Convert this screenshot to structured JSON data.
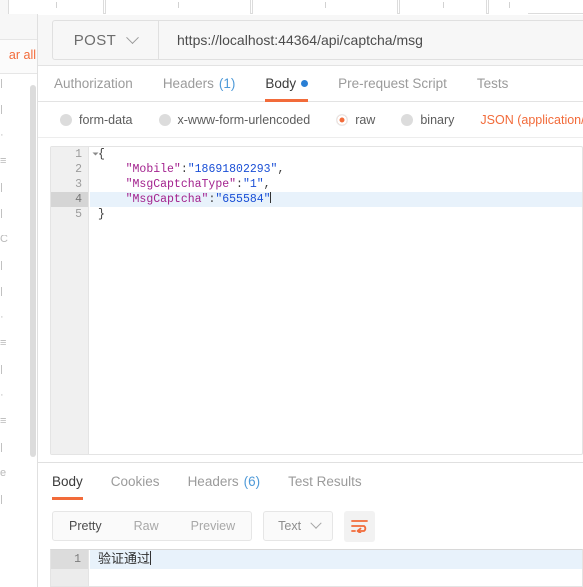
{
  "sidebar": {
    "clear_all_label": "ar all",
    "truncated_items": [
      "|",
      "|",
      "·",
      "≡",
      "|",
      "|",
      "C",
      "|",
      "|",
      "·",
      "≡",
      "|",
      "·",
      "≡",
      "|",
      "e",
      "|"
    ]
  },
  "request": {
    "method": "POST",
    "url": "https://localhost:44364/api/captcha/msg",
    "tabs": [
      {
        "label": "Authorization",
        "count": "",
        "active": false,
        "dot": false
      },
      {
        "label": "Headers",
        "count": "(1)",
        "active": false,
        "dot": false
      },
      {
        "label": "Body",
        "count": "",
        "active": true,
        "dot": true
      },
      {
        "label": "Pre-request Script",
        "count": "",
        "active": false,
        "dot": false
      },
      {
        "label": "Tests",
        "count": "",
        "active": false,
        "dot": false
      }
    ],
    "body_types": [
      {
        "label": "form-data",
        "selected": false
      },
      {
        "label": "x-www-form-urlencoded",
        "selected": false
      },
      {
        "label": "raw",
        "selected": true
      },
      {
        "label": "binary",
        "selected": false
      }
    ],
    "content_type_label": "JSON (application/json",
    "editor": {
      "active_line": 4,
      "lines": [
        {
          "n": "1",
          "fold": true,
          "tokens": [
            {
              "t": "{",
              "c": "p"
            }
          ]
        },
        {
          "n": "2",
          "fold": false,
          "tokens": [
            {
              "t": "    ",
              "c": "p"
            },
            {
              "t": "\"Mobile\"",
              "c": "k"
            },
            {
              "t": ":",
              "c": "p"
            },
            {
              "t": "\"18691802293\"",
              "c": "v"
            },
            {
              "t": ",",
              "c": "p"
            }
          ]
        },
        {
          "n": "3",
          "fold": false,
          "tokens": [
            {
              "t": "    ",
              "c": "p"
            },
            {
              "t": "\"MsgCaptchaType\"",
              "c": "k"
            },
            {
              "t": ":",
              "c": "p"
            },
            {
              "t": "\"1\"",
              "c": "v"
            },
            {
              "t": ",",
              "c": "p"
            }
          ]
        },
        {
          "n": "4",
          "fold": false,
          "tokens": [
            {
              "t": "    ",
              "c": "p"
            },
            {
              "t": "\"MsgCaptcha\"",
              "c": "k"
            },
            {
              "t": ":",
              "c": "p"
            },
            {
              "t": "\"655584\"",
              "c": "v"
            }
          ]
        },
        {
          "n": "5",
          "fold": false,
          "tokens": [
            {
              "t": "}",
              "c": "p"
            }
          ]
        }
      ]
    }
  },
  "response": {
    "tabs": [
      {
        "label": "Body",
        "count": "",
        "active": true
      },
      {
        "label": "Cookies",
        "count": "",
        "active": false
      },
      {
        "label": "Headers",
        "count": "(6)",
        "active": false
      },
      {
        "label": "Test Results",
        "count": "",
        "active": false
      }
    ],
    "view_modes": [
      {
        "label": "Pretty",
        "active": true
      },
      {
        "label": "Raw",
        "active": false
      },
      {
        "label": "Preview",
        "active": false
      }
    ],
    "format_label": "Text",
    "wrap_icon": "wrap-lines-icon",
    "body_lines": [
      {
        "n": "1",
        "text": "验证通过"
      }
    ]
  },
  "colors": {
    "accent": "#f26b3a",
    "link": "#4f9ad8",
    "dot": "#2a7fd4",
    "json_key": "#a3228e",
    "json_value": "#1a4fd6"
  }
}
